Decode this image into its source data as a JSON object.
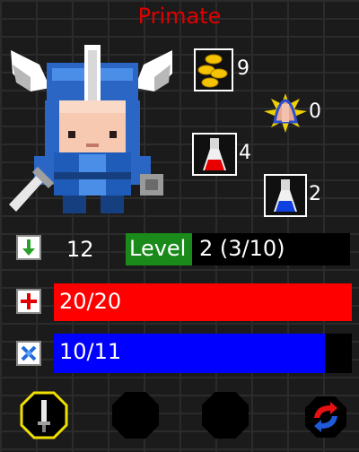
{
  "hero": {
    "name": "Primate"
  },
  "inventory": {
    "gold": {
      "icon": "gold-coins-icon",
      "count": "9"
    },
    "relic": {
      "icon": "golden-hands-relic-icon",
      "count": "0"
    },
    "red_potion": {
      "icon": "red-potion-icon",
      "count": "4"
    },
    "blue_potion": {
      "icon": "blue-potion-icon",
      "count": "2"
    }
  },
  "stats": {
    "depth_icon": "green-arrow-down-icon",
    "depth": "12",
    "level_label": "Level",
    "level_value": "2 (3/10)",
    "xp_fraction": 0.3,
    "health_icon": "red-cross-icon",
    "health_text": "20/20",
    "health_fraction": 1.0,
    "mana_icon": "blue-crossed-icon",
    "mana_text": "10/11",
    "mana_fraction": 0.909
  },
  "slots": [
    {
      "name": "equipped-weapon-slot",
      "icon": "sword-icon"
    },
    {
      "name": "empty-slot-1",
      "icon": ""
    },
    {
      "name": "empty-slot-2",
      "icon": ""
    },
    {
      "name": "swap-slot",
      "icon": "swap-arrows-icon"
    }
  ],
  "colors": {
    "title": "#e00000",
    "health": "#ff0000",
    "mana": "#0000ff",
    "level_badge": "#1a8a1a",
    "slot_highlight": "#f0e000"
  }
}
